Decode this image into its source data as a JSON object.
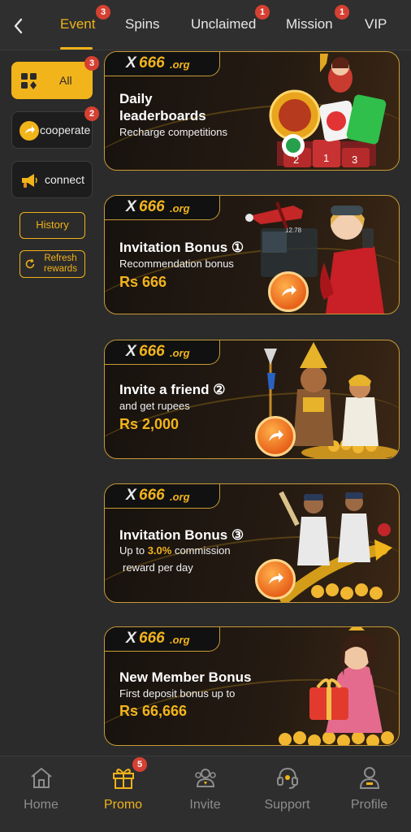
{
  "tabs": [
    {
      "label": "Event",
      "badge": "3"
    },
    {
      "label": "Spins",
      "badge": ""
    },
    {
      "label": "Unclaimed",
      "badge": "1"
    },
    {
      "label": "Mission",
      "badge": "1"
    },
    {
      "label": "VIP",
      "badge": ""
    }
  ],
  "sidebar": {
    "items": [
      {
        "label": "All",
        "badge": "3",
        "icon": "grid-icon"
      },
      {
        "label": "cooperate",
        "badge": "2",
        "icon": "share-arrow-icon"
      },
      {
        "label": "connect",
        "badge": "",
        "icon": "megaphone-icon"
      }
    ],
    "history_label": "History",
    "refresh_label": "Refresh rewards"
  },
  "banners": [
    {
      "logo_x": "X",
      "logo_num": "666",
      "logo_org": ".org",
      "title": "Daily leaderboards",
      "subtitle": "Recharge competitions",
      "podium": [
        "2",
        "1",
        "3"
      ]
    },
    {
      "title": "Invitation Bonus ①",
      "subtitle": "Recommendation bonus",
      "amount": "Rs 666",
      "extra": "12.78"
    },
    {
      "title": "Invite a friend ②",
      "subtitle": "and get rupees",
      "amount": "Rs 2,000"
    },
    {
      "title": "Invitation Bonus ③",
      "subtitle_prefix": "Up to ",
      "subtitle_accent": "3.0%",
      "subtitle_suffix": " commission",
      "subtitle2": "reward per day"
    },
    {
      "title": "New Member Bonus",
      "subtitle": "First deposit bonus up to",
      "amount": "Rs 66,666"
    }
  ],
  "bottom_nav": [
    {
      "label": "Home",
      "icon": "home-icon"
    },
    {
      "label": "Promo",
      "icon": "gift-icon",
      "badge": "5"
    },
    {
      "label": "Invite",
      "icon": "users-icon"
    },
    {
      "label": "Support",
      "icon": "headset-icon"
    },
    {
      "label": "Profile",
      "icon": "person-icon"
    }
  ],
  "colors": {
    "accent": "#f0b21a",
    "badge": "#d64032",
    "background": "#2b2b2b"
  }
}
